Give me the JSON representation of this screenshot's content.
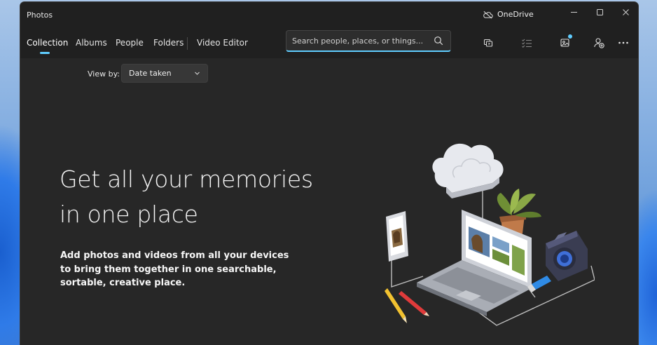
{
  "window": {
    "app_title": "Photos",
    "onedrive_label": "OneDrive"
  },
  "nav": {
    "tabs": [
      {
        "label": "Collection",
        "active": true
      },
      {
        "label": "Albums",
        "active": false
      },
      {
        "label": "People",
        "active": false
      },
      {
        "label": "Folders",
        "active": false
      },
      {
        "label": "Video Editor",
        "active": false
      }
    ],
    "search": {
      "placeholder": "Search people, places, or things...",
      "value": ""
    },
    "toolbar_icons": [
      "slideshow-icon",
      "select-icon",
      "import-icon",
      "account-icon",
      "more-icon"
    ]
  },
  "content": {
    "viewby_label": "View by:",
    "viewby_value": "Date taken",
    "headline_line1": "Get all your memories",
    "headline_line2": "in one place",
    "subtext": "Add photos and videos from all your devices to bring them together in one searchable, sortable, creative place."
  },
  "colors": {
    "accent": "#60cdff",
    "background": "#272727",
    "titlebar": "#202020"
  }
}
